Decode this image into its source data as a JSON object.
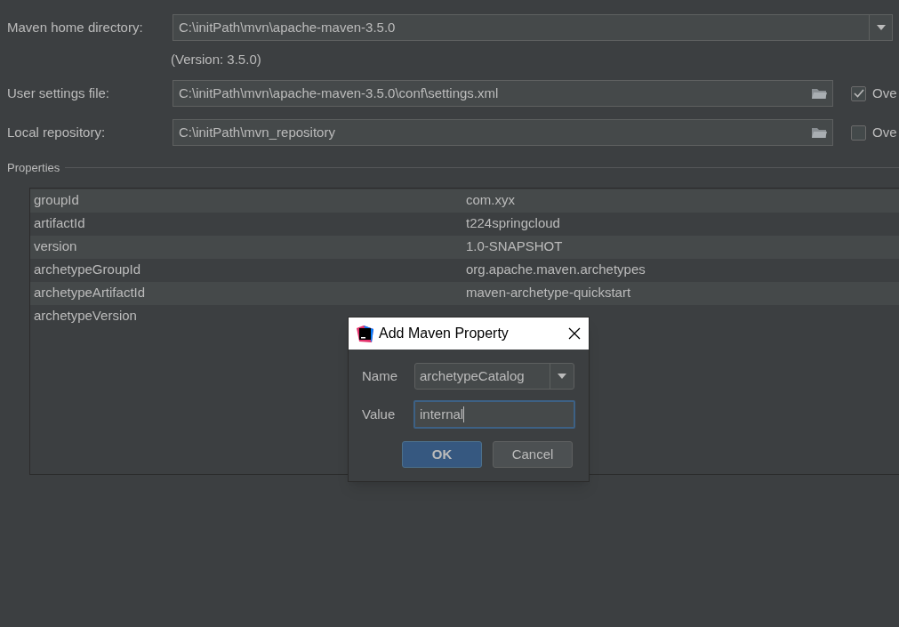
{
  "maven_home": {
    "label": "Maven home directory:",
    "value": "C:\\initPath\\mvn\\apache-maven-3.5.0",
    "version": "(Version: 3.5.0)"
  },
  "settings_rows": [
    {
      "label": "User settings file:",
      "value": "C:\\initPath\\mvn\\apache-maven-3.5.0\\conf\\settings.xml",
      "override": {
        "label": "Ove",
        "checked": true
      }
    },
    {
      "label": "Local repository:",
      "value": "C:\\initPath\\mvn_repository",
      "override": {
        "label": "Ove",
        "checked": false
      }
    }
  ],
  "properties": {
    "title": "Properties",
    "rows": [
      {
        "name": "groupId",
        "value": "com.xyx"
      },
      {
        "name": "artifactId",
        "value": "t224springcloud"
      },
      {
        "name": "version",
        "value": "1.0-SNAPSHOT"
      },
      {
        "name": "archetypeGroupId",
        "value": "org.apache.maven.archetypes"
      },
      {
        "name": "archetypeArtifactId",
        "value": "maven-archetype-quickstart"
      },
      {
        "name": "archetypeVersion"
      }
    ]
  },
  "dialog": {
    "title": "Add Maven Property",
    "name_label": "Name",
    "name_value": "archetypeCatalog",
    "value_label": "Value",
    "value_value": "internal",
    "buttons": [
      {
        "label": "OK",
        "kind": "primary"
      },
      {
        "label": "Cancel",
        "kind": "secondary"
      }
    ]
  }
}
